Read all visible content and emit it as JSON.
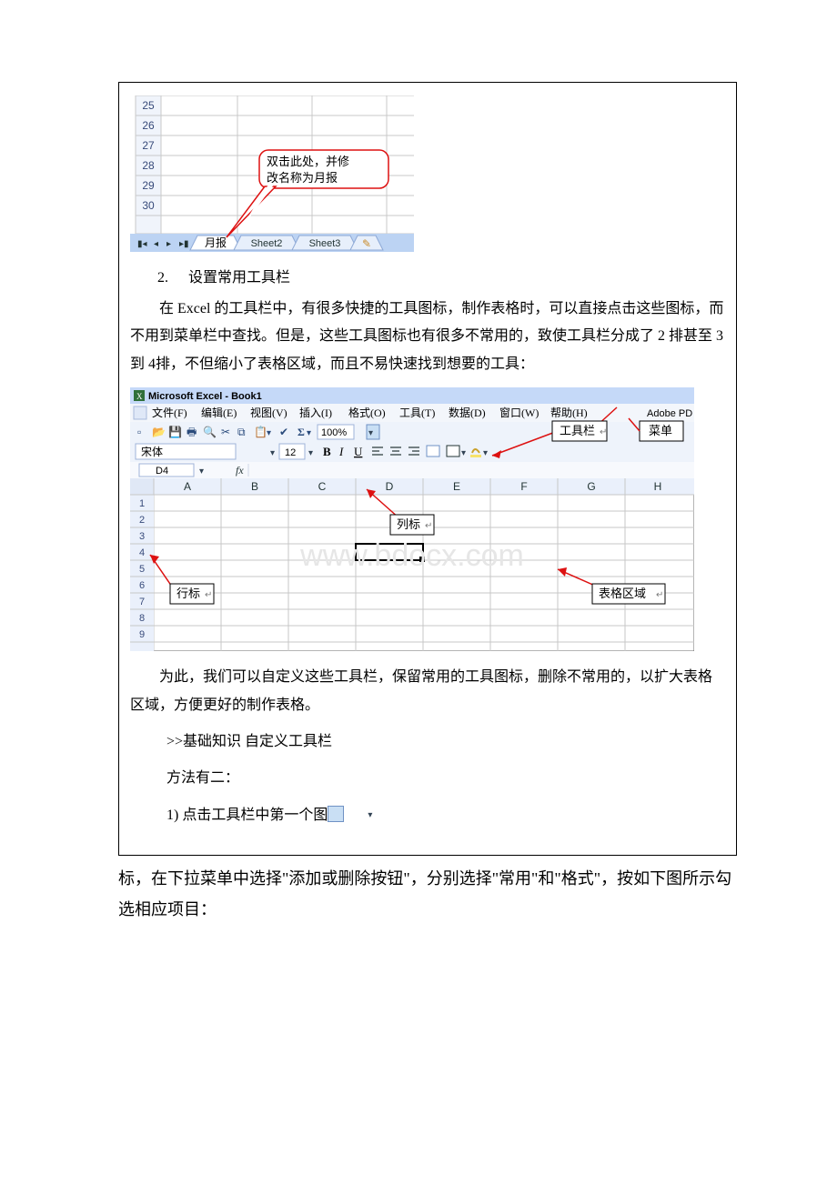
{
  "figure1": {
    "rows": [
      "25",
      "26",
      "27",
      "28",
      "29",
      "30"
    ],
    "sheet_tabs": [
      "月报",
      "Sheet2",
      "Sheet3"
    ],
    "callout": "双击此处，并修\n改名称为月报"
  },
  "heading_toolbars_num": "2.",
  "heading_toolbars": "设置常用工具栏",
  "para_toolbars_intro": "在 Excel 的工具栏中，有很多快捷的工具图标，制作表格时，可以直接点击这些图标，而不用到菜单栏中查找。但是，这些工具图标也有很多不常用的，致使工具栏分成了 2 排甚至 3 到 4排，不但缩小了表格区域，而且不易快速找到想要的工具：",
  "figure2": {
    "title": "Microsoft Excel - Book1",
    "menus": [
      "文件(F)",
      "编辑(E)",
      "视图(V)",
      "插入(I)",
      "格式(O)",
      "工具(T)",
      "数据(D)",
      "窗口(W)",
      "帮助(H)",
      "Adobe PD"
    ],
    "font_name": "宋体",
    "font_size": "12",
    "zoom": "100%",
    "namebox": "D4",
    "columns": [
      "A",
      "B",
      "C",
      "D",
      "E",
      "F",
      "G",
      "H"
    ],
    "rows": [
      "1",
      "2",
      "3",
      "4",
      "5",
      "6",
      "7",
      "8",
      "9"
    ],
    "labels": {
      "toolbar": "工具栏",
      "menubar": "菜单",
      "col_header": "列标",
      "row_header": "行标",
      "grid_area": "表格区域"
    },
    "watermark": "www.bdocx.com"
  },
  "para_customize": "为此，我们可以自定义这些工具栏，保留常用的工具图标，删除不常用的，以扩大表格区域，方便更好的制作表格。",
  "para_link": ">>基础知识 自定义工具栏",
  "para_methods": "方法有二：",
  "para_method1_lead": "1) 点击工具栏中第一个图",
  "para_method1_tail": "标，在下拉菜单中选择\"添加或删除按钮\"，分别选择\"常用\"和\"格式\"，按如下图所示勾选相应项目："
}
